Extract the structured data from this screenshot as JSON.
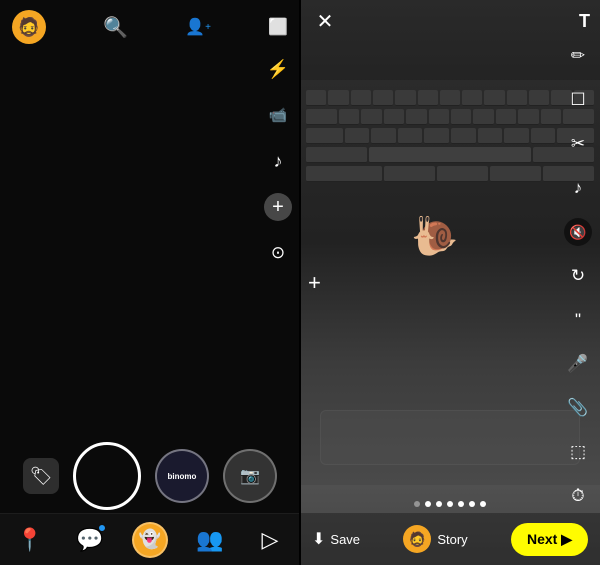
{
  "left": {
    "avatar_emoji": "🧔",
    "toolbar": {
      "flash_icon": "⚡",
      "video_icon": "📹",
      "music_icon": "♪",
      "plus_icon": "+",
      "focus_icon": "⊙"
    },
    "lens_options": {
      "binomo_label": "binomo",
      "photo_label": "📷"
    },
    "nav": {
      "map_icon": "📍",
      "chat_icon": "💬",
      "snap_icon": "👻",
      "friends_icon": "👥",
      "discover_icon": "▷"
    }
  },
  "right": {
    "toolbar": {
      "text_icon": "T",
      "pen_icon": "✏",
      "scissors_icon": "✂",
      "music_icon": "♪",
      "mute_icon": "🔇",
      "refresh_icon": "↻",
      "quote_icon": "❝",
      "mic_icon": "🎤",
      "attach_icon": "📎",
      "crop_icon": "⬜",
      "timer_icon": "⏱"
    },
    "page_dots": [
      false,
      true,
      true,
      true,
      true,
      true,
      true
    ],
    "bottom_bar": {
      "save_label": "Save",
      "story_label": "Story",
      "next_label": "Next ▶"
    },
    "snail": "🐌",
    "plus_label": "+"
  }
}
